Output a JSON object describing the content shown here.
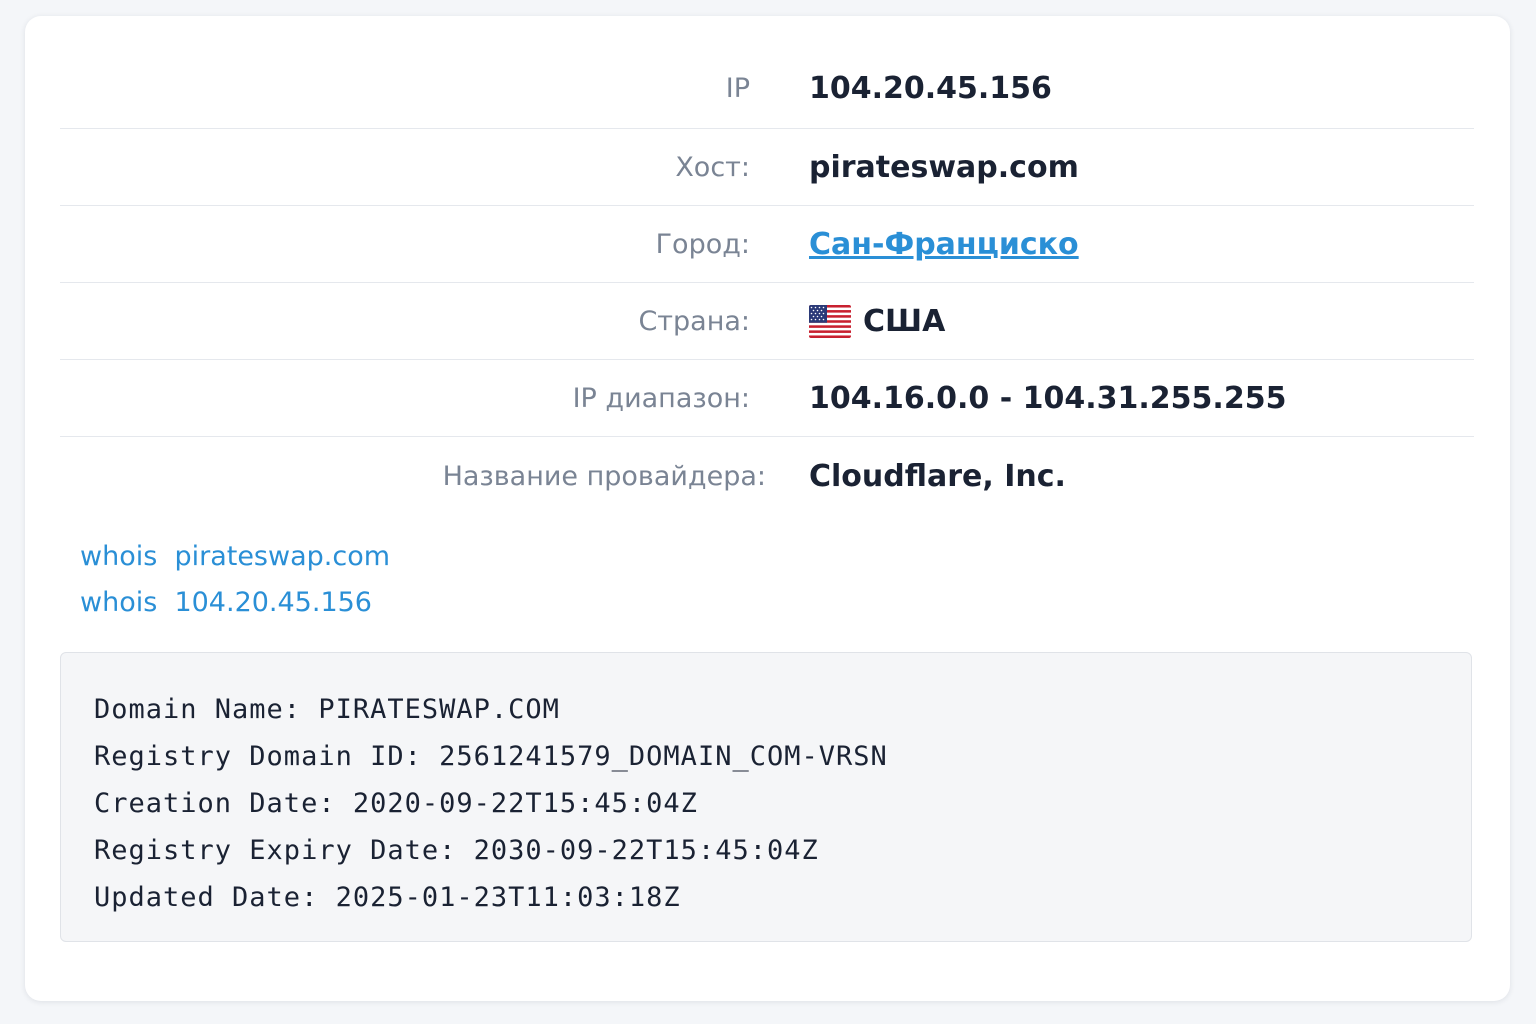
{
  "colors": {
    "link": "#2a8fd6",
    "label": "#7a8494",
    "value": "#1a2233",
    "divider": "#e5e8ed"
  },
  "info": {
    "ip": {
      "label": "IP",
      "value": "104.20.45.156"
    },
    "host": {
      "label": "Хост:",
      "value": "pirateswap.com"
    },
    "city": {
      "label": "Город:",
      "value": "Сан-Франциско"
    },
    "country": {
      "label": "Страна:",
      "value": "США",
      "flag_icon": "us-flag-icon"
    },
    "ip_range": {
      "label": "IP диапазон:",
      "value": "104.16.0.0 - 104.31.255.255"
    },
    "provider": {
      "label": "Название провайдера:",
      "value": "Cloudflare, Inc."
    }
  },
  "whois_links": [
    {
      "text": "whois  pirateswap.com"
    },
    {
      "text": "whois  104.20.45.156"
    }
  ],
  "whois_record": [
    "Domain Name: PIRATESWAP.COM",
    "Registry Domain ID: 2561241579_DOMAIN_COM-VRSN",
    "Creation Date: 2020-09-22T15:45:04Z",
    "Registry Expiry Date: 2030-09-22T15:45:04Z",
    "Updated Date: 2025-01-23T11:03:18Z"
  ]
}
